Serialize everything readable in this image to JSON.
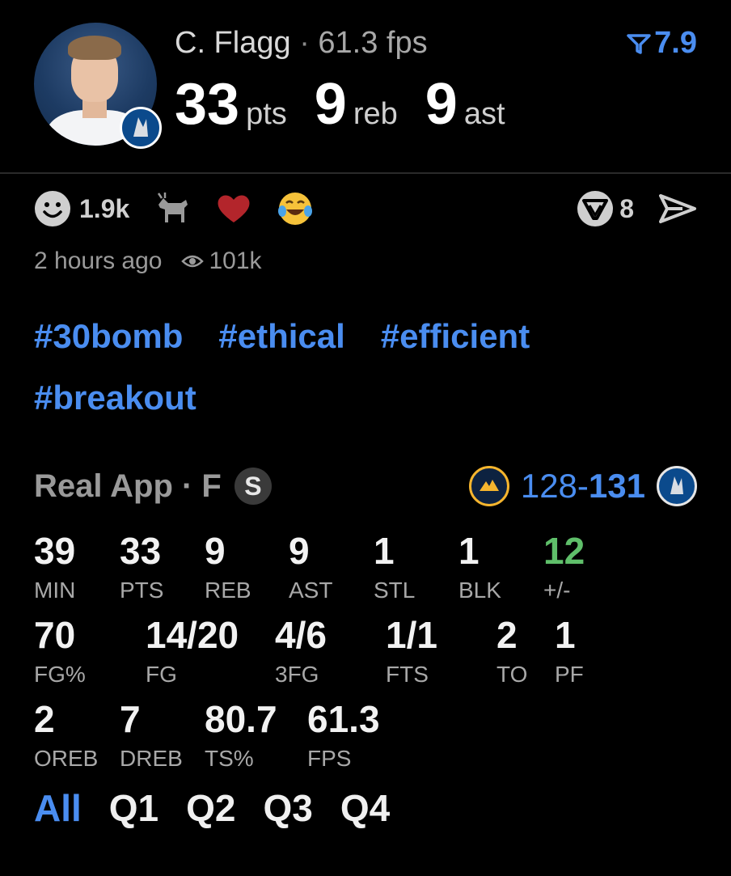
{
  "header": {
    "player_name": "C. Flagg",
    "separator": "·",
    "fps_text": "61.3 fps",
    "rating": "7.9",
    "stats": [
      {
        "value": "33",
        "unit": "pts"
      },
      {
        "value": "9",
        "unit": "reb"
      },
      {
        "value": "9",
        "unit": "ast"
      }
    ]
  },
  "reactions": {
    "smile_count": "1.9k",
    "icons": [
      "smile-icon",
      "goat-icon",
      "heart-icon",
      "laugh-cry-icon"
    ],
    "comment_count": "8"
  },
  "meta": {
    "time_ago": "2 hours ago",
    "views": "101k"
  },
  "tags": [
    "#30bomb",
    "#ethical",
    "#efficient",
    "#breakout"
  ],
  "game": {
    "label": "Real App · F",
    "status_badge": "S",
    "score_left": "128",
    "score_dash": "-",
    "score_right": "131"
  },
  "box": {
    "row1": [
      {
        "value": "39",
        "label": "MIN"
      },
      {
        "value": "33",
        "label": "PTS"
      },
      {
        "value": "9",
        "label": "REB"
      },
      {
        "value": "9",
        "label": "AST"
      },
      {
        "value": "1",
        "label": "STL"
      },
      {
        "value": "1",
        "label": "BLK"
      },
      {
        "value": "12",
        "label": "+/-"
      }
    ],
    "row2": [
      {
        "value": "70",
        "label": "FG%"
      },
      {
        "value": "14/20",
        "label": "FG"
      },
      {
        "value": "4/6",
        "label": "3FG"
      },
      {
        "value": "1/1",
        "label": "FTS"
      },
      {
        "value": "2",
        "label": "TO"
      },
      {
        "value": "1",
        "label": "PF"
      }
    ],
    "row3": [
      {
        "value": "2",
        "label": "OREB"
      },
      {
        "value": "7",
        "label": "DREB"
      },
      {
        "value": "80.7",
        "label": "TS%"
      },
      {
        "value": "61.3",
        "label": "FPS"
      }
    ]
  },
  "tabs": [
    "All",
    "Q1",
    "Q2",
    "Q3",
    "Q4"
  ],
  "colors": {
    "accent": "#4a8df0",
    "positive": "#5fbf6a",
    "background": "#000000"
  }
}
